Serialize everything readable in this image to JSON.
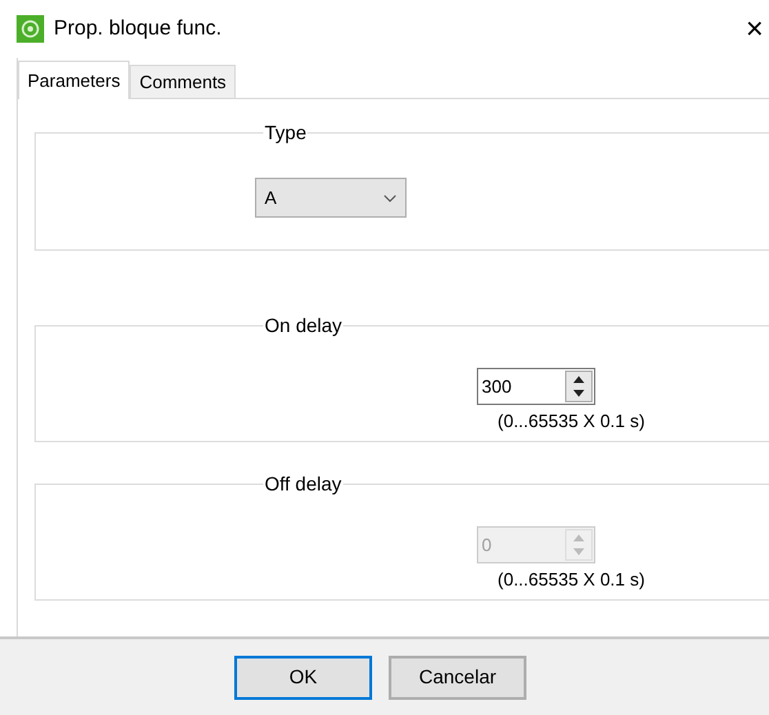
{
  "window": {
    "title": "Prop. bloque func.",
    "close": "×"
  },
  "tabs": [
    {
      "label": "Parameters",
      "selected": true
    },
    {
      "label": "Comments",
      "selected": false
    }
  ],
  "groups": [
    {
      "kind": "dropdown",
      "legend": "Type",
      "value": "A"
    },
    {
      "kind": "spinner",
      "legend": "On delay",
      "value": "300",
      "disabled": false,
      "range": "(0...65535 X 0.1 s)"
    },
    {
      "kind": "spinner",
      "legend": "Off delay",
      "value": "0",
      "disabled": true,
      "range": "(0...65535 X 0.1 s)"
    }
  ],
  "buttons": [
    {
      "label": "OK",
      "default": true
    },
    {
      "label": "Cancelar",
      "default": false
    }
  ]
}
